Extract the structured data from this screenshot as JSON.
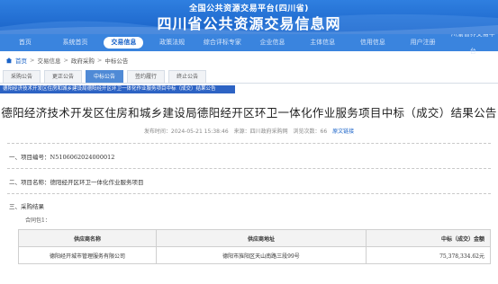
{
  "banner": {
    "subtitle": "全国公共资源交易平台(四川省)",
    "title": "四川省公共资源交易信息网"
  },
  "nav": {
    "items": [
      "首页",
      "系统首页",
      "交易信息",
      "政策法规",
      "综合评标专家",
      "企业信息",
      "主体信息",
      "信用信息",
      "用户注册",
      "川渝省界交易平台"
    ],
    "active_index": 2
  },
  "breadcrumb": {
    "home": "首页",
    "level1": "交易信息",
    "level2": "政府采购",
    "level3": "中标公告"
  },
  "tabs": [
    "采购公告",
    "更正公告",
    "中标公告",
    "签约履行",
    "终止公告"
  ],
  "active_tab": 2,
  "selected_text": "德阳经济技术开发区住房和城乡建设局德阳经开区环卫一体化作业服务项目中标（成交）结果公告",
  "article": {
    "title": "德阳经济技术开发区住房和城乡建设局德阳经开区环卫一体化作业服务项目中标（成交）结果公告",
    "time_label": "发布时间：2024-05-21 15:38:46",
    "source_label": "来源：四川政府采购网",
    "views_label": "浏览次数：66",
    "original_link": "原文链接"
  },
  "sections": {
    "project_no": "一、项目编号：N5106062024000012",
    "project_name": "二、项目名称：德阳经开区环卫一体化作业服务项目",
    "result": "三、采购结果",
    "package": "合同包1："
  },
  "table": {
    "headers": [
      "供应商名称",
      "供应商地址",
      "中标（成交）金额"
    ],
    "rows": [
      [
        "德阳经开城市管理服务有限公司",
        "德阳市旌阳区天山南路三段99号",
        "75,378,334.62元"
      ]
    ]
  },
  "colors": {
    "banner": "#1a63c8",
    "nav": "#3a84de",
    "accent": "#4f8ad6",
    "selection": "#2d63c4"
  }
}
